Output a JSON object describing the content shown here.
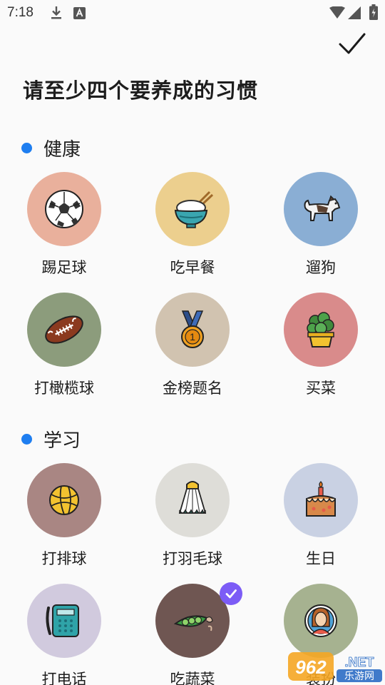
{
  "status_bar": {
    "time": "7:18"
  },
  "header": {
    "title": "请至少四个要养成的习惯"
  },
  "sections": [
    {
      "title": "健康",
      "items": [
        {
          "label": "踢足球",
          "icon": "soccer-ball-icon",
          "bg": "#e9b09c",
          "selected": false
        },
        {
          "label": "吃早餐",
          "icon": "rice-bowl-icon",
          "bg": "#eccf8e",
          "selected": false
        },
        {
          "label": "遛狗",
          "icon": "dog-icon",
          "bg": "#8aaed4",
          "selected": false
        },
        {
          "label": "打橄榄球",
          "icon": "rugby-ball-icon",
          "bg": "#8c9c7c",
          "selected": false
        },
        {
          "label": "金榜题名",
          "icon": "medal-icon",
          "bg": "#d1c3b0",
          "selected": false
        },
        {
          "label": "买菜",
          "icon": "potted-plant-icon",
          "bg": "#d98b8b",
          "selected": false
        }
      ]
    },
    {
      "title": "学习",
      "items": [
        {
          "label": "打排球",
          "icon": "volleyball-icon",
          "bg": "#a98683",
          "selected": false
        },
        {
          "label": "打羽毛球",
          "icon": "shuttlecock-icon",
          "bg": "#deddd8",
          "selected": false
        },
        {
          "label": "生日",
          "icon": "birthday-cake-icon",
          "bg": "#c9d1e3",
          "selected": false
        },
        {
          "label": "打电话",
          "icon": "telephone-icon",
          "bg": "#d1cade",
          "selected": false
        },
        {
          "label": "吃蔬菜",
          "icon": "peas-icon",
          "bg": "#6f5652",
          "selected": true
        },
        {
          "label": "装扮",
          "icon": "person-portrait-icon",
          "bg": "#a6b290",
          "selected": false
        }
      ]
    }
  ],
  "watermark": {
    "text_a": "962",
    "text_b": ".NET",
    "text_c": "乐游网"
  },
  "colors": {
    "accent_dot": "#1e7ef0",
    "check_badge": "#7c5cf6"
  }
}
